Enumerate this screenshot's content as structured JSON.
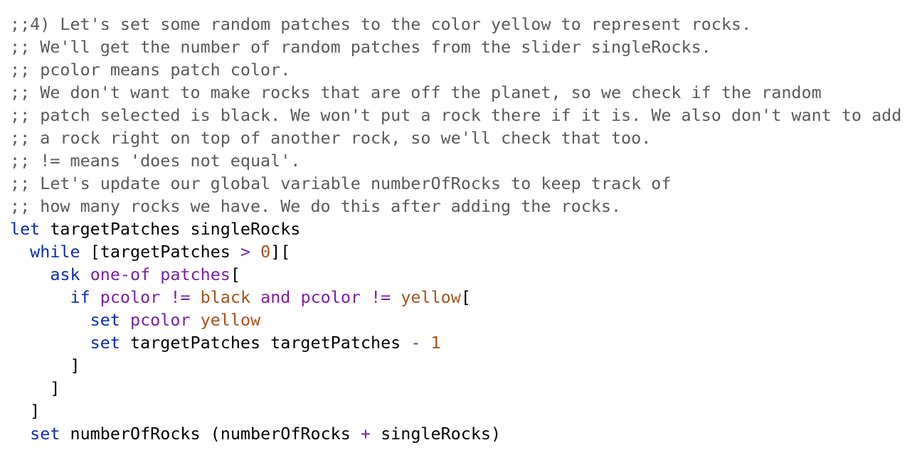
{
  "colors": {
    "comment": "#5a5a5a",
    "keyword": "#0b2cb8",
    "reporter": "#7a1fa8",
    "constant": "#a8521c",
    "plain": "#000000",
    "background": "#ffffff"
  },
  "lines": [
    [
      {
        "t": ";;4) Let's set some random patches to the color yellow to represent rocks.",
        "c": "comment"
      }
    ],
    [
      {
        "t": ";; We'll get the number of random patches from the slider singleRocks.",
        "c": "comment"
      }
    ],
    [
      {
        "t": ";; pcolor means patch color.",
        "c": "comment"
      }
    ],
    [
      {
        "t": ";; We don't want to make rocks that are off the planet, so we check if the random",
        "c": "comment"
      }
    ],
    [
      {
        "t": ";; patch selected is black. We won't put a rock there if it is. We also don't want to add",
        "c": "comment"
      }
    ],
    [
      {
        "t": ";; a rock right on top of another rock, so we'll check that too.",
        "c": "comment"
      }
    ],
    [
      {
        "t": ";; != means 'does not equal'.",
        "c": "comment"
      }
    ],
    [
      {
        "t": ";; Let's update our global variable numberOfRocks to keep track of",
        "c": "comment"
      }
    ],
    [
      {
        "t": ";; how many rocks we have. We do this after adding the rocks.",
        "c": "comment"
      }
    ],
    [
      {
        "t": "let",
        "c": "keyword"
      },
      {
        "t": " targetPatches singleRocks",
        "c": "plain"
      }
    ],
    [
      {
        "t": "  ",
        "c": "plain"
      },
      {
        "t": "while",
        "c": "keyword"
      },
      {
        "t": " [targetPatches ",
        "c": "plain"
      },
      {
        "t": ">",
        "c": "reporter"
      },
      {
        "t": " ",
        "c": "plain"
      },
      {
        "t": "0",
        "c": "constant"
      },
      {
        "t": "][",
        "c": "plain"
      }
    ],
    [
      {
        "t": "    ",
        "c": "plain"
      },
      {
        "t": "ask",
        "c": "keyword"
      },
      {
        "t": " ",
        "c": "plain"
      },
      {
        "t": "one-of",
        "c": "reporter"
      },
      {
        "t": " ",
        "c": "plain"
      },
      {
        "t": "patches",
        "c": "reporter"
      },
      {
        "t": "[",
        "c": "plain"
      }
    ],
    [
      {
        "t": "      ",
        "c": "plain"
      },
      {
        "t": "if",
        "c": "keyword"
      },
      {
        "t": " ",
        "c": "plain"
      },
      {
        "t": "pcolor",
        "c": "reporter"
      },
      {
        "t": " ",
        "c": "plain"
      },
      {
        "t": "!=",
        "c": "reporter"
      },
      {
        "t": " ",
        "c": "plain"
      },
      {
        "t": "black",
        "c": "constant"
      },
      {
        "t": " ",
        "c": "plain"
      },
      {
        "t": "and",
        "c": "reporter"
      },
      {
        "t": " ",
        "c": "plain"
      },
      {
        "t": "pcolor",
        "c": "reporter"
      },
      {
        "t": " ",
        "c": "plain"
      },
      {
        "t": "!=",
        "c": "reporter"
      },
      {
        "t": " ",
        "c": "plain"
      },
      {
        "t": "yellow",
        "c": "constant"
      },
      {
        "t": "[",
        "c": "plain"
      }
    ],
    [
      {
        "t": "        ",
        "c": "plain"
      },
      {
        "t": "set",
        "c": "keyword"
      },
      {
        "t": " ",
        "c": "plain"
      },
      {
        "t": "pcolor",
        "c": "reporter"
      },
      {
        "t": " ",
        "c": "plain"
      },
      {
        "t": "yellow",
        "c": "constant"
      }
    ],
    [
      {
        "t": "        ",
        "c": "plain"
      },
      {
        "t": "set",
        "c": "keyword"
      },
      {
        "t": " targetPatches targetPatches ",
        "c": "plain"
      },
      {
        "t": "-",
        "c": "reporter"
      },
      {
        "t": " ",
        "c": "plain"
      },
      {
        "t": "1",
        "c": "constant"
      }
    ],
    [
      {
        "t": "      ]",
        "c": "plain"
      }
    ],
    [
      {
        "t": "    ]",
        "c": "plain"
      }
    ],
    [
      {
        "t": "  ]",
        "c": "plain"
      }
    ],
    [
      {
        "t": "  ",
        "c": "plain"
      },
      {
        "t": "set",
        "c": "keyword"
      },
      {
        "t": " numberOfRocks (numberOfRocks ",
        "c": "plain"
      },
      {
        "t": "+",
        "c": "reporter"
      },
      {
        "t": " singleRocks)",
        "c": "plain"
      }
    ]
  ]
}
